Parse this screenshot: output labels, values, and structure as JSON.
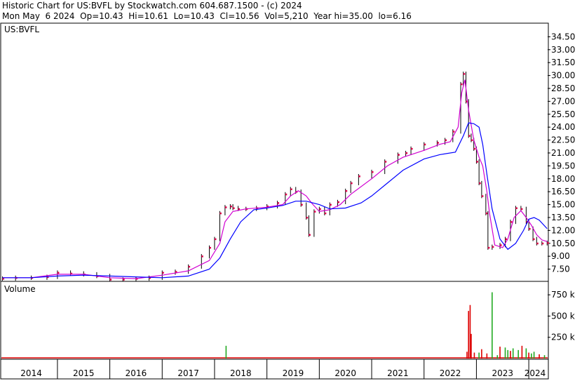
{
  "header": {
    "line1": "Historic Chart for US:BVFL by Stockwatch.com 604.687.1500 - (c) 2024",
    "line2": "Mon May  6 2024  Op=10.43  Hi=10.61  Lo=10.43  Cl=10.56  Vol=5,210  Year hi=35.00  lo=6.16"
  },
  "colors": {
    "price_tick": "#e0004a",
    "bar": "#000000",
    "ma_short": "#d100d1",
    "ma_long": "#0000ff",
    "volume_up": "#22aa22",
    "volume_down": "#dd0000"
  },
  "chart_data": [
    {
      "type": "line",
      "symbol": "US:BVFL",
      "ylim": [
        6.16,
        36.0
      ],
      "y_ticks": [
        7.5,
        9.0,
        10.5,
        12.0,
        13.5,
        15.0,
        16.5,
        18.0,
        19.5,
        21.0,
        22.5,
        24.0,
        25.5,
        27.0,
        28.5,
        30.0,
        31.5,
        33.0,
        34.5
      ],
      "y_tick_labels": [
        "7.50",
        "9.00",
        "10.50",
        "12.00",
        "13.50",
        "15.00",
        "16.50",
        "18.00",
        "19.50",
        "21.00",
        "22.50",
        "24.00",
        "25.50",
        "27.00",
        "28.50",
        "30.00",
        "31.50",
        "33.00",
        "34.50"
      ],
      "x_range": [
        2013.93,
        2024.36
      ],
      "grid": false,
      "series": [
        {
          "key": "close",
          "x": [
            2013.95,
            2014.2,
            2014.5,
            2014.8,
            2015.0,
            2015.25,
            2015.5,
            2015.75,
            2016.0,
            2016.25,
            2016.5,
            2016.75,
            2017.0,
            2017.25,
            2017.5,
            2017.75,
            2017.9,
            2018.0,
            2018.1,
            2018.2,
            2018.3,
            2018.35,
            2018.45,
            2018.6,
            2018.8,
            2019.0,
            2019.2,
            2019.35,
            2019.45,
            2019.55,
            2019.65,
            2019.75,
            2019.8,
            2019.9,
            2020.0,
            2020.1,
            2020.2,
            2020.35,
            2020.5,
            2020.6,
            2020.75,
            2021.0,
            2021.25,
            2021.5,
            2021.65,
            2021.75,
            2022.0,
            2022.25,
            2022.4,
            2022.55,
            2022.7,
            2022.75,
            2022.8,
            2022.85,
            2022.9,
            2022.95,
            2023.0,
            2023.05,
            2023.1,
            2023.18,
            2023.22,
            2023.3,
            2023.45,
            2023.55,
            2023.65,
            2023.75,
            2023.85,
            2023.95,
            2024.0,
            2024.08,
            2024.15,
            2024.25,
            2024.35
          ],
          "values": [
            6.4,
            6.5,
            6.5,
            6.6,
            7.1,
            7.0,
            6.9,
            6.7,
            6.3,
            6.3,
            6.4,
            6.5,
            7.1,
            7.2,
            7.8,
            9.0,
            10.0,
            11.0,
            14.0,
            14.7,
            14.8,
            14.6,
            14.5,
            14.5,
            14.6,
            14.8,
            15.2,
            16.2,
            16.8,
            16.5,
            15.0,
            13.5,
            11.5,
            14.2,
            14.5,
            14.0,
            15.0,
            15.3,
            16.6,
            17.5,
            18.3,
            18.8,
            20.0,
            20.8,
            21.0,
            21.5,
            22.0,
            22.2,
            22.5,
            23.5,
            29.0,
            30.2,
            27.0,
            23.0,
            22.5,
            21.5,
            20.0,
            17.5,
            16.0,
            14.0,
            10.0,
            10.1,
            10.3,
            11.0,
            13.0,
            14.6,
            14.5,
            13.0,
            12.2,
            11.0,
            10.5,
            10.5,
            10.56
          ]
        },
        {
          "key": "ma_short",
          "x": [
            2013.95,
            2014.5,
            2015.0,
            2015.5,
            2016.0,
            2016.5,
            2017.0,
            2017.5,
            2017.9,
            2018.1,
            2018.2,
            2018.35,
            2018.6,
            2019.0,
            2019.3,
            2019.45,
            2019.6,
            2019.75,
            2019.85,
            2020.0,
            2020.2,
            2020.4,
            2020.6,
            2021.0,
            2021.3,
            2021.6,
            2022.0,
            2022.3,
            2022.5,
            2022.65,
            2022.72,
            2022.78,
            2022.85,
            2022.95,
            2023.05,
            2023.12,
            2023.2,
            2023.25,
            2023.35,
            2023.5,
            2023.6,
            2023.72,
            2023.85,
            2023.95,
            2024.05,
            2024.15,
            2024.25,
            2024.35
          ],
          "values": [
            6.5,
            6.5,
            6.9,
            6.9,
            6.5,
            6.4,
            6.8,
            7.3,
            8.5,
            10.5,
            13.0,
            14.2,
            14.5,
            14.7,
            15.0,
            16.0,
            16.6,
            16.0,
            15.2,
            14.2,
            14.4,
            15.0,
            16.2,
            18.0,
            19.5,
            20.5,
            21.3,
            22.0,
            22.3,
            24.0,
            28.0,
            29.5,
            26.0,
            22.5,
            20.5,
            19.5,
            16.5,
            14.0,
            10.3,
            10.0,
            11.0,
            13.5,
            14.3,
            13.5,
            12.6,
            11.5,
            10.9,
            10.7
          ]
        },
        {
          "key": "ma_long",
          "x": [
            2013.95,
            2014.5,
            2015.0,
            2015.5,
            2016.0,
            2016.5,
            2017.0,
            2017.5,
            2017.9,
            2018.1,
            2018.3,
            2018.5,
            2018.75,
            2019.0,
            2019.3,
            2019.55,
            2019.75,
            2020.0,
            2020.2,
            2020.5,
            2020.8,
            2021.0,
            2021.3,
            2021.6,
            2022.0,
            2022.3,
            2022.6,
            2022.75,
            2022.85,
            2022.95,
            2023.05,
            2023.12,
            2023.2,
            2023.3,
            2023.45,
            2023.6,
            2023.75,
            2023.9,
            2024.0,
            2024.1,
            2024.2,
            2024.35
          ],
          "values": [
            6.5,
            6.5,
            6.7,
            6.8,
            6.7,
            6.6,
            6.5,
            6.7,
            7.5,
            8.8,
            11.0,
            13.0,
            14.4,
            14.6,
            14.9,
            15.4,
            15.4,
            15.0,
            14.5,
            14.6,
            15.2,
            16.0,
            17.5,
            19.0,
            20.3,
            20.8,
            21.1,
            23.0,
            24.5,
            24.4,
            24.0,
            22.0,
            18.5,
            14.5,
            11.0,
            9.8,
            10.5,
            12.0,
            13.3,
            13.5,
            13.2,
            12.2
          ]
        }
      ]
    },
    {
      "type": "bar",
      "title": "Volume",
      "ylim": [
        0,
        900
      ],
      "y_ticks": [
        250,
        500,
        750
      ],
      "y_tick_labels": [
        "250 k",
        "500 k",
        "750 k"
      ],
      "x_categories": [
        "2014",
        "2015",
        "2016",
        "2017",
        "2018",
        "2019",
        "2020",
        "2021",
        "2022",
        "2023",
        "2024"
      ],
      "x_positions": [
        2014.0,
        2015.0,
        2016.0,
        2017.0,
        2018.0,
        2019.0,
        2020.0,
        2021.0,
        2022.0,
        2023.0,
        2024.0
      ],
      "x": [
        2018.22,
        2022.82,
        2022.85,
        2022.88,
        2022.9,
        2022.96,
        2023.05,
        2023.1,
        2023.2,
        2023.3,
        2023.4,
        2023.45,
        2023.55,
        2023.6,
        2023.65,
        2023.7,
        2023.8,
        2023.87,
        2023.95,
        2024.0,
        2024.05,
        2024.1,
        2024.2,
        2024.3
      ],
      "values": [
        150,
        80,
        560,
        630,
        290,
        70,
        70,
        110,
        60,
        780,
        40,
        140,
        130,
        100,
        90,
        120,
        100,
        150,
        120,
        70,
        60,
        80,
        50,
        40
      ],
      "up": [
        true,
        false,
        false,
        false,
        false,
        false,
        true,
        false,
        false,
        true,
        true,
        false,
        true,
        true,
        false,
        true,
        true,
        false,
        true,
        false,
        true,
        true,
        false,
        true
      ]
    }
  ]
}
